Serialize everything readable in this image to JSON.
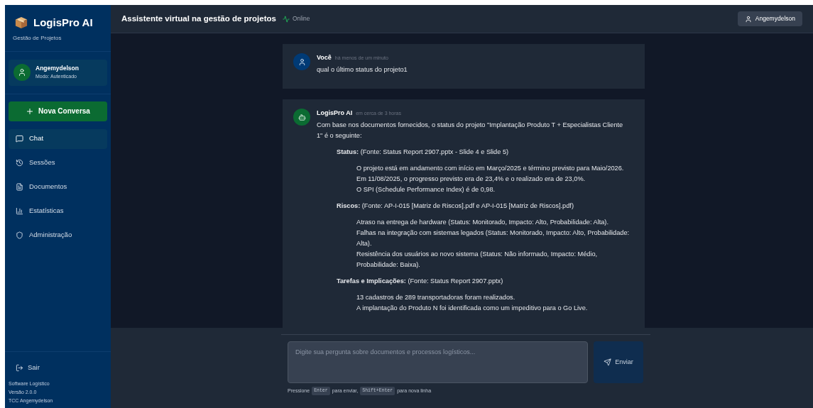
{
  "sidebar": {
    "brand": "LogisPro AI",
    "subtitle": "Gestão de Projetos",
    "user": {
      "name": "Angemydelson",
      "mode": "Modo: Autenticado"
    },
    "new_button": "Nova Conversa",
    "items": [
      {
        "label": "Chat",
        "kind": "chat",
        "selected": true
      },
      {
        "label": "Sessões",
        "kind": "history",
        "selected": false
      },
      {
        "label": "Documentos",
        "kind": "document",
        "selected": false
      },
      {
        "label": "Estatísticas",
        "kind": "chart",
        "selected": false
      },
      {
        "label": "Administração",
        "kind": "shield",
        "selected": false
      }
    ],
    "logout": "Sair",
    "footer": [
      "Software Logístico",
      "Versão 2.0.0",
      "TCC Angemydelson"
    ]
  },
  "header": {
    "title": "Assistente virtual na gestão de projetos",
    "status": "Online",
    "user": "Angemydelson"
  },
  "messages": [
    {
      "kind": "user",
      "author": "Você",
      "time": "há menos de um minuto",
      "blocks": [
        {
          "kind": "paragraph",
          "text": "qual o último status do projeto1"
        }
      ]
    },
    {
      "kind": "bot",
      "author": "LogisPro AI",
      "time": "em cerca de 3 horas",
      "blocks": [
        {
          "kind": "paragraph",
          "text": "Com base nos documentos fornecidos, o status do projeto \"Implantação Produto T + Especialistas Cliente 1\" é o seguinte:"
        },
        {
          "kind": "section",
          "text": "**Status:** (Fonte: Status Report 2907.pptx - Slide 4 e Slide 5)",
          "items": [
            "O projeto está em andamento com início em Março/2025 e término previsto para Maio/2026.",
            "Em 11/08/2025, o progresso previsto era de 23,4% e o realizado era de 23,0%.",
            "O SPI (Schedule Performance Index) é de 0,98."
          ]
        },
        {
          "kind": "section",
          "text": "**Riscos:** (Fonte: AP-I-015 [Matriz de Riscos].pdf e AP-I-015 [Matriz de Riscos].pdf)",
          "items": [
            "Atraso na entrega de hardware (Status: Monitorado, Impacto: Alto, Probabilidade: Alta).",
            "Falhas na integração com sistemas legados (Status: Monitorado, Impacto: Alto, Probabilidade: Alta).",
            "Resistência dos usuários ao novo sistema (Status: Não informado, Impacto: Médio, Probabilidade: Baixa)."
          ]
        },
        {
          "kind": "section",
          "text": "**Tarefas e Implicações:** (Fonte: Status Report 2907.pptx)",
          "items": [
            "13 cadastros de 289 transportadoras foram realizados.",
            "A implantação do Produto N foi identificada como um impeditivo para o Go Live."
          ]
        }
      ]
    }
  ],
  "composer": {
    "placeholder": "Digite sua pergunta sobre documentos e processos logísticos...",
    "send": "Enviar",
    "hint": [
      {
        "kind": "text",
        "text": "Pressione"
      },
      {
        "kind": "key",
        "text": "Enter"
      },
      {
        "kind": "text",
        "text": "para enviar,"
      },
      {
        "kind": "key",
        "text": "Shift+Enter"
      },
      {
        "kind": "text",
        "text": "para nova linha"
      }
    ]
  }
}
